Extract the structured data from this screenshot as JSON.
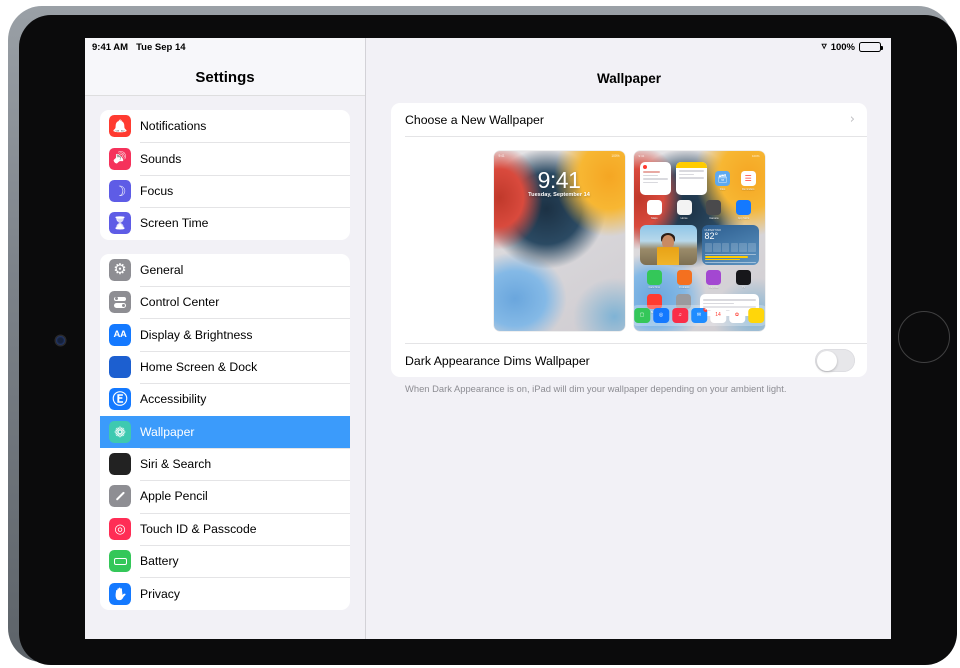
{
  "status_bar": {
    "time": "9:41 AM",
    "date": "Tue Sep 14",
    "wifi_icon": "wifi-icon",
    "battery_percent": "100%",
    "battery_icon": "battery-full-icon"
  },
  "sidebar": {
    "title": "Settings",
    "groups": [
      {
        "items": [
          {
            "label": "Notifications",
            "icon": "bell-icon",
            "color": "#ff3b30"
          },
          {
            "label": "Sounds",
            "icon": "speaker-icon",
            "color": "#f5325b"
          },
          {
            "label": "Focus",
            "icon": "moon-icon",
            "color": "#5e5ce6"
          },
          {
            "label": "Screen Time",
            "icon": "hourglass-icon",
            "color": "#5e5ce6"
          }
        ]
      },
      {
        "items": [
          {
            "label": "General",
            "icon": "gear-icon",
            "color": "#8e8e93"
          },
          {
            "label": "Control Center",
            "icon": "sliders-icon",
            "color": "#8e8e93"
          },
          {
            "label": "Display & Brightness",
            "icon": "aa-icon",
            "color": "#1479ff"
          },
          {
            "label": "Home Screen & Dock",
            "icon": "app-grid-icon",
            "color": "#1c5fd0"
          },
          {
            "label": "Accessibility",
            "icon": "accessibility-icon",
            "color": "#1479ff"
          },
          {
            "label": "Wallpaper",
            "icon": "flower-icon",
            "color": "#3ec9b0",
            "selected": true
          },
          {
            "label": "Siri & Search",
            "icon": "siri-icon",
            "color": "#222222"
          },
          {
            "label": "Apple Pencil",
            "icon": "pencil-icon",
            "color": "#8e8e93"
          },
          {
            "label": "Touch ID & Passcode",
            "icon": "fingerprint-icon",
            "color": "#ff2d55"
          },
          {
            "label": "Battery",
            "icon": "battery-icon",
            "color": "#34c759"
          },
          {
            "label": "Privacy",
            "icon": "hand-icon",
            "color": "#1479ff"
          }
        ]
      }
    ]
  },
  "detail": {
    "title": "Wallpaper",
    "choose_row": {
      "label": "Choose a New Wallpaper",
      "chevron": "›"
    },
    "previews": {
      "lock_screen": {
        "name": "lock-screen-preview",
        "time": "9:41",
        "date": "Tuesday, September 14",
        "status_left": "9:41",
        "status_right": "100%"
      },
      "home_screen": {
        "name": "home-screen-preview",
        "weather_temp": "82°",
        "weather_label": "CUPERTINO",
        "apps_row1": [
          {
            "label": "Maps",
            "color": "#ffffff"
          },
          {
            "label": "Home",
            "color": "#f3f3f3"
          },
          {
            "label": "Camera",
            "color": "#4a4a4c"
          },
          {
            "label": "App Store",
            "color": "#1479ff"
          }
        ],
        "apps_row2": [
          {
            "label": "FaceTime",
            "color": "#34c759"
          },
          {
            "label": "Podcasts",
            "color": "#f4701f"
          },
          {
            "label": "Keynote",
            "color": "#a347d1"
          },
          {
            "label": "TV",
            "color": "#17171a"
          }
        ],
        "apps_row3": [
          {
            "label": "Books",
            "color": "#ff3b30"
          },
          {
            "label": "Settings",
            "color": "#9a9a9e"
          }
        ],
        "dock": [
          {
            "label": "Messages",
            "color": "#34c759",
            "glyph": "▢"
          },
          {
            "label": "Safari",
            "color": "#1479ff",
            "glyph": "◎"
          },
          {
            "label": "Music",
            "color": "#fa2d48",
            "glyph": "♫"
          },
          {
            "label": "Mail",
            "color": "#1f8cff",
            "glyph": "✉",
            "badge": "4"
          },
          {
            "label": "Calendar",
            "color": "#ffffff",
            "glyph": "14"
          },
          {
            "label": "Photos",
            "color": "#ffffff",
            "glyph": "✿"
          },
          {
            "label": "Notes",
            "color": "#ffd60a",
            "glyph": ""
          }
        ]
      }
    },
    "dark_dim_row": {
      "label": "Dark Appearance Dims Wallpaper",
      "toggle_state": "off"
    },
    "footnote": "When Dark Appearance is on, iPad will dim your wallpaper depending on your ambient light."
  },
  "colors": {
    "accent": "#3b9bfb",
    "screen_bg": "#f2f1f6",
    "card_bg": "#ffffff",
    "separator": "#e4e4e6",
    "footnote_text": "#8d8d93"
  }
}
